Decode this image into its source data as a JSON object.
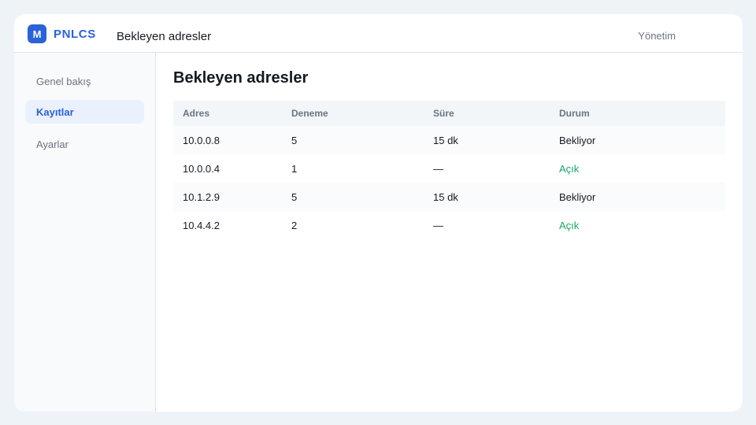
{
  "app": {
    "logo_letter": "M",
    "brand": "PNLCS",
    "title": "Bekleyen adresler",
    "admin_label": "Yönetim"
  },
  "sidebar": {
    "items": [
      {
        "label": "Genel bakış",
        "active": false
      },
      {
        "label": "Kayıtlar",
        "active": true
      },
      {
        "label": "Ayarlar",
        "active": false
      }
    ]
  },
  "main": {
    "title": "Bekleyen adresler",
    "table": {
      "columns": [
        "Adres",
        "Deneme",
        "Süre",
        "Durum"
      ],
      "rows": [
        {
          "address": "10.0.0.8",
          "attempts": "5",
          "duration": "15 dk",
          "status": "Bekliyor"
        },
        {
          "address": "10.0.0.4",
          "attempts": "1",
          "duration": "—",
          "status": "Açık"
        },
        {
          "address": "10.1.2.9",
          "attempts": "5",
          "duration": "15 dk",
          "status": "Bekliyor"
        },
        {
          "address": "10.4.4.2",
          "attempts": "2",
          "duration": "—",
          "status": "Açık"
        }
      ]
    }
  },
  "colors": {
    "accent": "#2a62d9",
    "status_open": "#17a567",
    "muted": "#6b7480"
  }
}
